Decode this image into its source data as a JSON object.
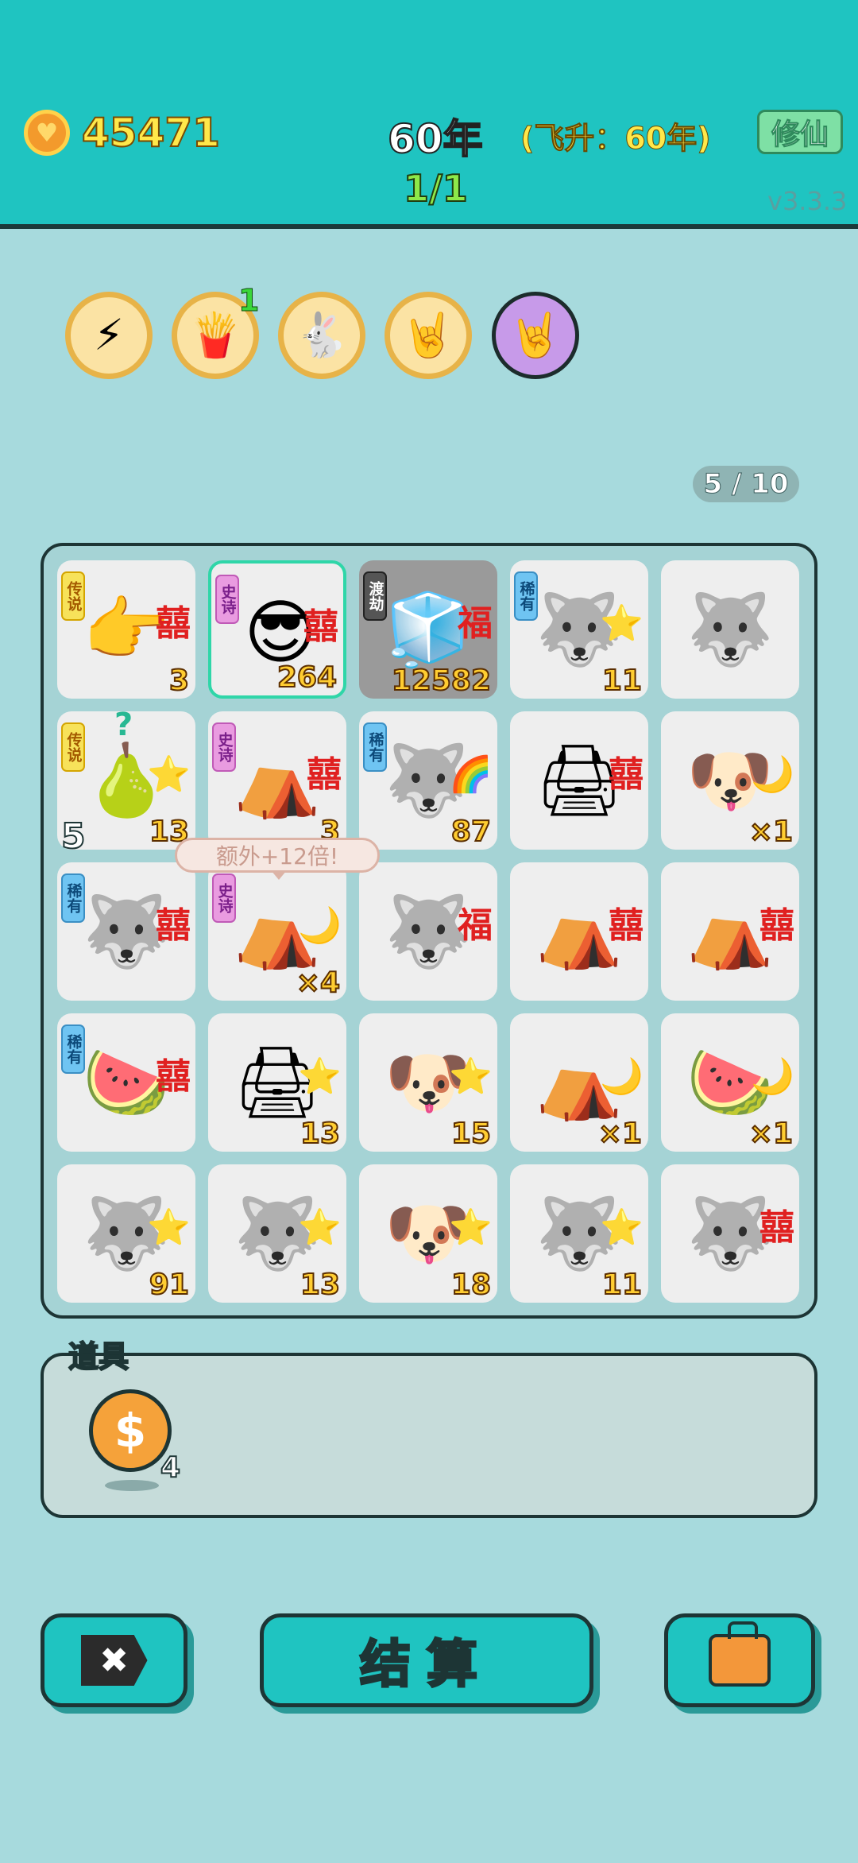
{
  "header": {
    "coins": "45471",
    "year": "60年",
    "ascend": "(飞升：60年)",
    "round": "1/1",
    "xiuxian_label": "修仙",
    "version": "v3.3.3"
  },
  "buffs": [
    {
      "name": "lightning-buff-icon",
      "glyph": "⚡",
      "style": "gold"
    },
    {
      "name": "fries-buff-icon",
      "glyph": "🍟",
      "style": "gold"
    },
    {
      "name": "bunny-buff-icon",
      "glyph": "🐇",
      "style": "gold"
    },
    {
      "name": "rock-hand-buff-icon",
      "glyph": "🤘",
      "style": "gold"
    },
    {
      "name": "rock-hand-buff-icon-2",
      "glyph": "🤘",
      "style": "purple"
    }
  ],
  "buff_count": "1",
  "page_indicator": "5 / 10",
  "grid": [
    {
      "tag": "传说",
      "tag_type": "leg",
      "icon": "pointing-hand-icon",
      "glyph": "👉",
      "badge": "囍",
      "num": "3"
    },
    {
      "tag": "史诗",
      "tag_type": "epic",
      "icon": "cool-guy-icon",
      "glyph": "😎",
      "badge": "囍",
      "num": "264",
      "selected": true
    },
    {
      "tag": "渡劫",
      "tag_type": "tri",
      "icon": "fridge-icon",
      "glyph": "🧊",
      "badge": "福",
      "num": "12582",
      "gray": true
    },
    {
      "tag": "稀有",
      "tag_type": "rare",
      "icon": "husky-icon",
      "glyph": "🐺",
      "badge": "⭐",
      "num": "11"
    },
    {
      "tag": "",
      "tag_type": "",
      "icon": "husky-icon",
      "glyph": "🐺",
      "badge": "",
      "num": ""
    },
    {
      "tag": "传说",
      "tag_type": "leg",
      "icon": "pear-icon",
      "glyph": "🍐",
      "badge": "⭐",
      "num": "13",
      "qmark": "?"
    },
    {
      "tag": "史诗",
      "tag_type": "epic",
      "icon": "bunny-tent-icon",
      "glyph": "⛺",
      "badge": "囍",
      "num": "3"
    },
    {
      "tag": "稀有",
      "tag_type": "rare",
      "icon": "husky-icon",
      "glyph": "🐺",
      "badge": "🌈",
      "num": "87"
    },
    {
      "tag": "",
      "tag_type": "",
      "icon": "printer-icon",
      "glyph": "🖨",
      "badge": "囍",
      "num": ""
    },
    {
      "tag": "",
      "tag_type": "",
      "icon": "king-husky-icon",
      "glyph": "🐶",
      "badge": "🌙",
      "num": "×1"
    },
    {
      "tag": "稀有",
      "tag_type": "rare",
      "icon": "husky-icon",
      "glyph": "🐺",
      "badge": "囍",
      "num": ""
    },
    {
      "tag": "史诗",
      "tag_type": "epic",
      "icon": "bunny-tent-icon",
      "glyph": "⛺",
      "badge": "🌙",
      "num": "×4"
    },
    {
      "tag": "",
      "tag_type": "",
      "icon": "husky-icon",
      "glyph": "🐺",
      "badge": "福",
      "num": ""
    },
    {
      "tag": "",
      "tag_type": "",
      "icon": "bunny-tent-icon",
      "glyph": "⛺",
      "badge": "囍",
      "num": ""
    },
    {
      "tag": "",
      "tag_type": "",
      "icon": "bunny-tent-icon",
      "glyph": "⛺",
      "badge": "囍",
      "num": ""
    },
    {
      "tag": "稀有",
      "tag_type": "rare",
      "icon": "watermelon-icon",
      "glyph": "🍉",
      "badge": "囍",
      "num": ""
    },
    {
      "tag": "",
      "tag_type": "",
      "icon": "printer-icon",
      "glyph": "🖨",
      "badge": "⭐",
      "num": "13"
    },
    {
      "tag": "",
      "tag_type": "",
      "icon": "king-husky-icon",
      "glyph": "🐶",
      "badge": "⭐",
      "num": "15"
    },
    {
      "tag": "",
      "tag_type": "",
      "icon": "bunny-tent-icon",
      "glyph": "⛺",
      "badge": "🌙",
      "num": "×1"
    },
    {
      "tag": "",
      "tag_type": "",
      "icon": "watermelon-icon",
      "glyph": "🍉",
      "badge": "🌙",
      "num": "×1"
    },
    {
      "tag": "",
      "tag_type": "",
      "icon": "husky-icon",
      "glyph": "🐺",
      "badge": "⭐",
      "num": "91"
    },
    {
      "tag": "",
      "tag_type": "",
      "icon": "husky-icon",
      "glyph": "🐺",
      "badge": "⭐",
      "num": "13"
    },
    {
      "tag": "",
      "tag_type": "",
      "icon": "king-husky-icon",
      "glyph": "🐶",
      "badge": "⭐",
      "num": "18"
    },
    {
      "tag": "",
      "tag_type": "",
      "icon": "husky-icon",
      "glyph": "🐺",
      "badge": "⭐",
      "num": "11"
    },
    {
      "tag": "",
      "tag_type": "",
      "icon": "husky-icon",
      "glyph": "🐺",
      "badge": "囍",
      "num": ""
    }
  ],
  "left_five": "5",
  "tooltip": "额外+12倍!",
  "items": {
    "title": "道具",
    "dollar_glyph": "$",
    "dollar_count": "4"
  },
  "buttons": {
    "settle_label": "结算",
    "close_glyph": "✖"
  }
}
